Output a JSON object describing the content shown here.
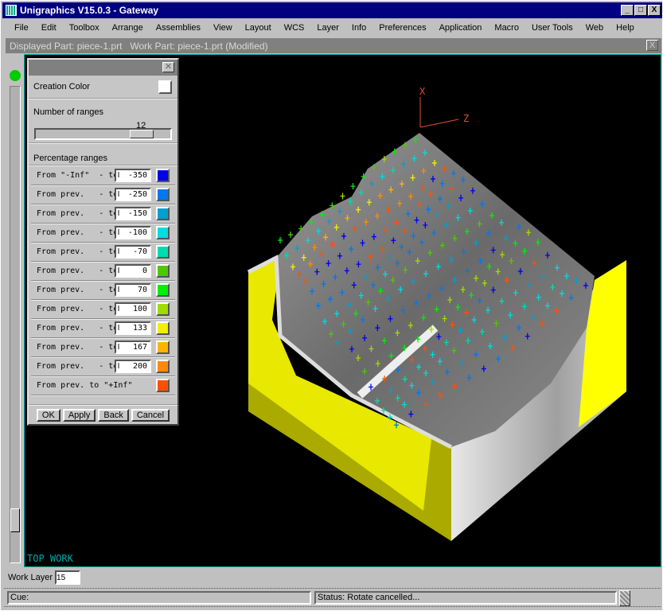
{
  "window": {
    "title": "Unigraphics V15.0.3 - Gateway",
    "controls": [
      "minimize",
      "maximize",
      "close"
    ]
  },
  "menu": [
    "File",
    "Edit",
    "Toolbox",
    "Arrange",
    "Assemblies",
    "View",
    "Layout",
    "WCS",
    "Layer",
    "Info",
    "Preferences",
    "Application",
    "Macro",
    "User Tools",
    "Web",
    "Help"
  ],
  "part_header": {
    "text": "Displayed Part: piece-1.prt   Work Part: piece-1.prt (Modified)"
  },
  "viewport": {
    "label": "TOP WORK",
    "axis_x": "X",
    "axis_z": "Z"
  },
  "dialog": {
    "creation_color_label": "Creation Color",
    "creation_color": "#ffffff",
    "num_ranges_label": "Number of ranges",
    "num_ranges": "12",
    "slider_fraction": 0.75,
    "pct_label": "Percentage ranges",
    "ranges": [
      {
        "label": "From \"-Inf\"  - to",
        "value": "-350",
        "color": "#0000f0"
      },
      {
        "label": "From prev.   - to",
        "value": "-250",
        "color": "#0078f0"
      },
      {
        "label": "From prev.   - to",
        "value": "-150",
        "color": "#00a0d0"
      },
      {
        "label": "From prev.   - to",
        "value": "-100",
        "color": "#00dce0"
      },
      {
        "label": "From prev.   - to",
        "value": "-70",
        "color": "#00dcb0"
      },
      {
        "label": "From prev.   - to",
        "value": "0",
        "color": "#50c800"
      },
      {
        "label": "From prev.   - to",
        "value": "70",
        "color": "#00f000"
      },
      {
        "label": "From prev.   - to",
        "value": "100",
        "color": "#a0dc00"
      },
      {
        "label": "From prev.   - to",
        "value": "133",
        "color": "#f0f000"
      },
      {
        "label": "From prev.   - to",
        "value": "167",
        "color": "#ffb400"
      },
      {
        "label": "From prev.   - to",
        "value": "200",
        "color": "#ff8c00"
      },
      {
        "label": "From prev. to \"+Inf\"",
        "value": null,
        "color": "#ff5000"
      }
    ],
    "buttons": {
      "ok": "OK",
      "apply": "Apply",
      "back": "Back",
      "cancel": "Cancel"
    }
  },
  "work_layer": {
    "label": "Work Layer",
    "value": "15"
  },
  "statusbar": {
    "cue": "Cue:",
    "status": "Status: Rotate cancelled..."
  }
}
